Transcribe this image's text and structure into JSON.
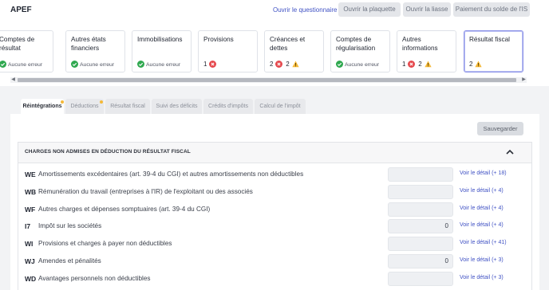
{
  "header": {
    "app_title": "APEF",
    "link_questionnaire": "Ouvrir le questionnaire",
    "btn_plaquette": "Ouvrir la plaquette",
    "btn_liasse": "Ouvrir la liasse",
    "btn_paiement": "Paiement du solde de l'IS"
  },
  "cards": [
    {
      "title": "Comptes de résultat",
      "status_text": "Aucune erreur",
      "status": "ok"
    },
    {
      "title": "Autres états financiers",
      "status_text": "Aucune erreur",
      "status": "ok"
    },
    {
      "title": "Immobilisations",
      "status_text": "Aucune erreur",
      "status": "ok"
    },
    {
      "title": "Provisions",
      "errors": "1",
      "status": "error"
    },
    {
      "title": "Créances et dettes",
      "errors": "2",
      "warnings": "2",
      "status": "mixed"
    },
    {
      "title": "Comptes de régularisation",
      "status_text": "Aucune erreur",
      "status": "ok"
    },
    {
      "title": "Autres informations",
      "errors": "1",
      "warnings": "2",
      "status": "mixed"
    },
    {
      "title": "Résultat fiscal",
      "warnings": "2",
      "status": "warning"
    }
  ],
  "tabs": [
    "Réintégrations",
    "Déductions",
    "Résultat fiscal",
    "Suivi des déficits",
    "Crédits d'impôts",
    "Calcul de l'impôt"
  ],
  "save_label": "Sauvegarder",
  "section": {
    "title": "CHARGES NON ADMISES EN DÉDUCTION DU RÉSULTAT FISCAL",
    "rows": [
      {
        "code": "WE",
        "label": "Amortissements excédentaires (art. 39-4 du CGI) et autres amortissements non déductibles",
        "value": "",
        "detail": "Voir le détail (+ 18)"
      },
      {
        "code": "WB",
        "label": "Rémunération du travail (entreprises à l'IR) de l'exploitant ou des associés",
        "value": "",
        "detail": "Voir le détail (+ 4)"
      },
      {
        "code": "WF",
        "label": "Autres charges et dépenses somptuaires (art. 39-4 du CGI)",
        "value": "",
        "detail": "Voir le détail (+ 4)"
      },
      {
        "code": "I7",
        "label": "Impôt sur les sociétés",
        "value": "0",
        "detail": "Voir le détail (+ 4)"
      },
      {
        "code": "WI",
        "label": "Provisions et charges à payer non déductibles",
        "value": "",
        "detail": "Voir le détail (+ 41)"
      },
      {
        "code": "WJ",
        "label": "Amendes et pénalités",
        "value": "0",
        "detail": "Voir le détail (+ 3)"
      },
      {
        "code": "WD",
        "label": "Avantages personnels non déductibles",
        "value": "",
        "detail": "Voir le détail (+ 3)"
      }
    ]
  },
  "colors": {
    "accent": "#4052c4",
    "ok": "#2fa84f",
    "error": "#e5484d",
    "warning": "#f5b938"
  }
}
